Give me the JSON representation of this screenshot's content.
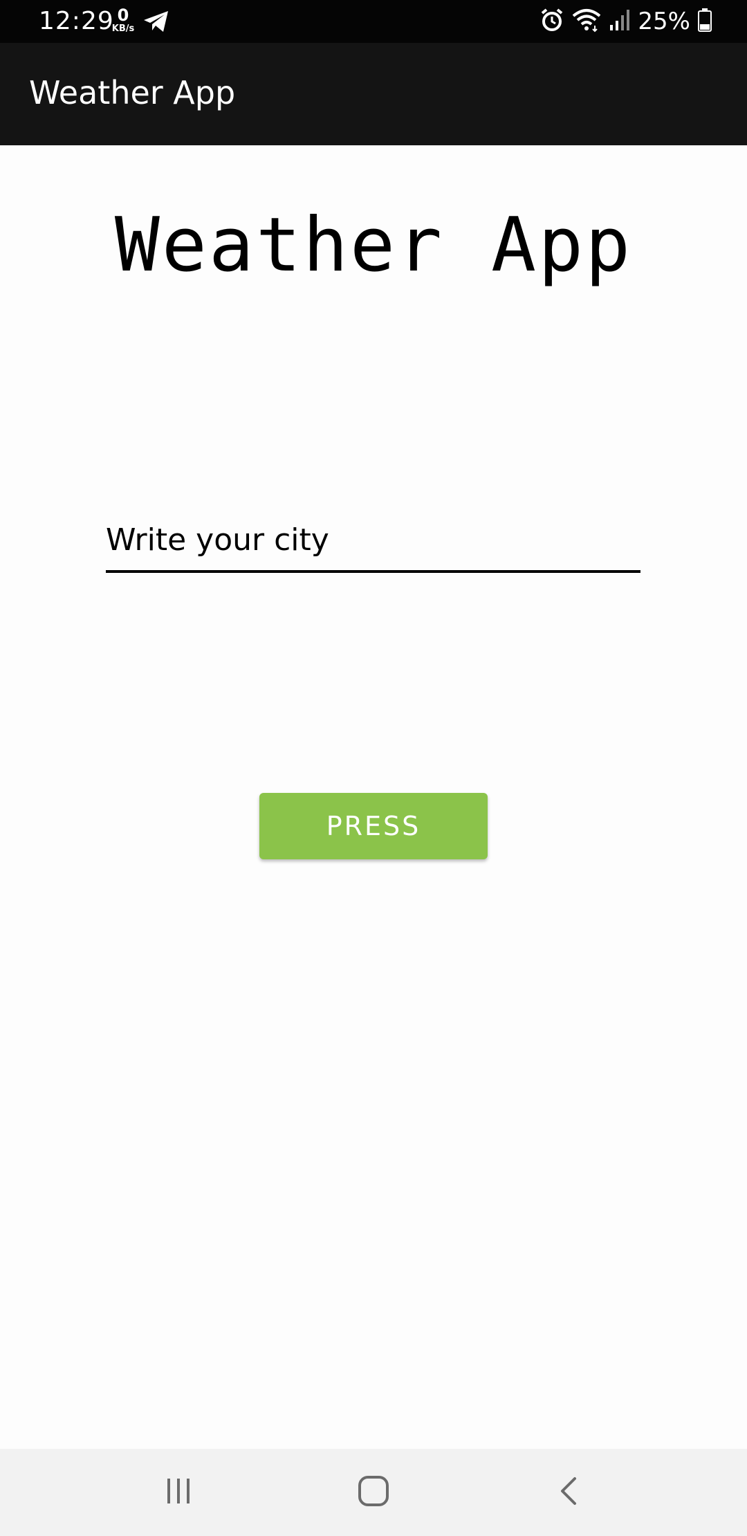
{
  "status_bar": {
    "time": "12:29",
    "net_speed_value": "0",
    "net_speed_unit": "KB/s",
    "battery_percent": "25%",
    "icons": [
      "telegram-icon",
      "alarm-icon",
      "wifi-icon",
      "signal-icon",
      "battery-icon"
    ]
  },
  "app_bar": {
    "title": "Weather App"
  },
  "main": {
    "heading": "Weather App",
    "city_input": {
      "placeholder": "Write your city",
      "value": ""
    },
    "press_button_label": "PRESS"
  },
  "nav_bar": {
    "icons": [
      "recents-icon",
      "home-icon",
      "back-icon"
    ]
  },
  "colors": {
    "status_bar_bg": "#050505",
    "app_bar_bg": "#141414",
    "button_bg": "#8bc34a",
    "nav_bar_bg": "#f2f2f2"
  }
}
